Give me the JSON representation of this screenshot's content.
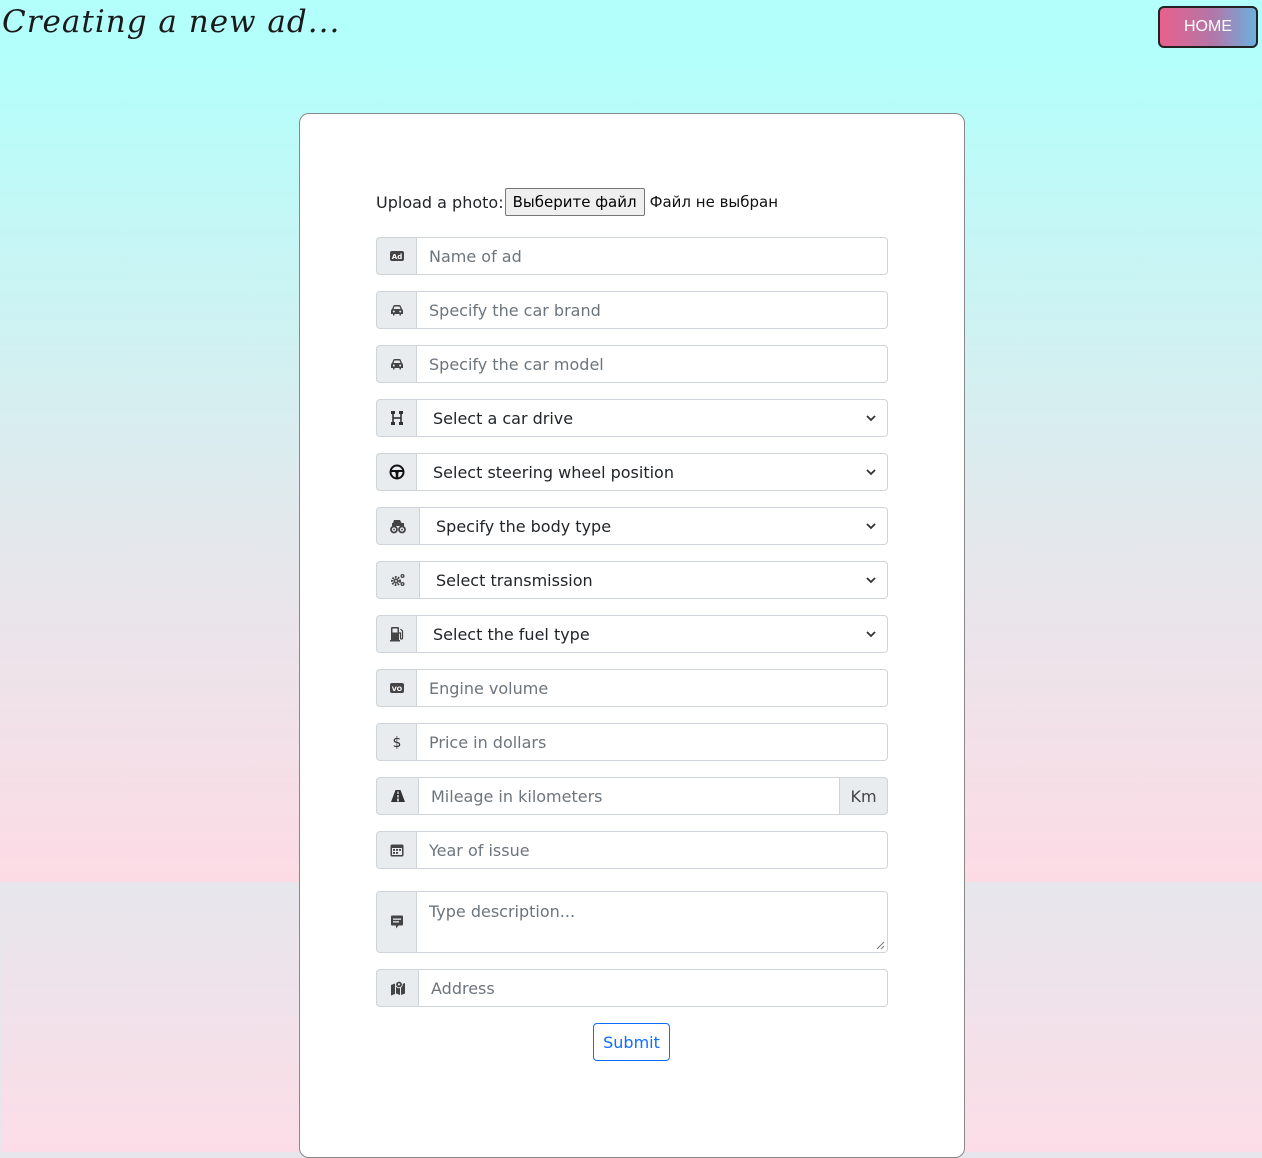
{
  "header": {
    "title": "Creating a new ad...",
    "home_label": "HOME"
  },
  "form": {
    "upload": {
      "label": "Upload a photo:",
      "button": "Выберите файл",
      "status": "Файл не выбран"
    },
    "fields": {
      "ad_name": {
        "placeholder": "Name of ad",
        "icon": "ad-icon"
      },
      "brand": {
        "placeholder": "Specify the car brand",
        "icon": "car-icon"
      },
      "model": {
        "placeholder": "Specify the car model",
        "icon": "car-icon"
      },
      "drive": {
        "value": "Select a car drive",
        "icon": "drivetrain-icon"
      },
      "steering": {
        "value": "Select steering wheel position",
        "icon": "steering-wheel-icon"
      },
      "body": {
        "value": "Specify the body type",
        "icon": "monster-truck-icon"
      },
      "transmission": {
        "value": "Select transmission",
        "icon": "gears-icon"
      },
      "fuel": {
        "value": "Select the fuel type",
        "icon": "fuel-pump-icon"
      },
      "engine": {
        "placeholder": "Engine volume",
        "icon": "vo-icon"
      },
      "price": {
        "placeholder": "Price in dollars",
        "icon": "dollar-icon"
      },
      "mileage": {
        "placeholder": "Mileage in kilometers",
        "unit": "Km",
        "icon": "road-icon"
      },
      "year": {
        "placeholder": "Year of issue",
        "icon": "calendar-icon"
      },
      "description": {
        "placeholder": "Type description...",
        "icon": "comment-icon"
      },
      "address": {
        "placeholder": "Address",
        "icon": "map-location-icon"
      }
    },
    "submit_label": "Submit"
  },
  "colors": {
    "accent": "#0d6efd",
    "bg_top": "#b3fffb",
    "bg_bottom": "#fddbe5",
    "addon_bg": "#e9ecef"
  }
}
